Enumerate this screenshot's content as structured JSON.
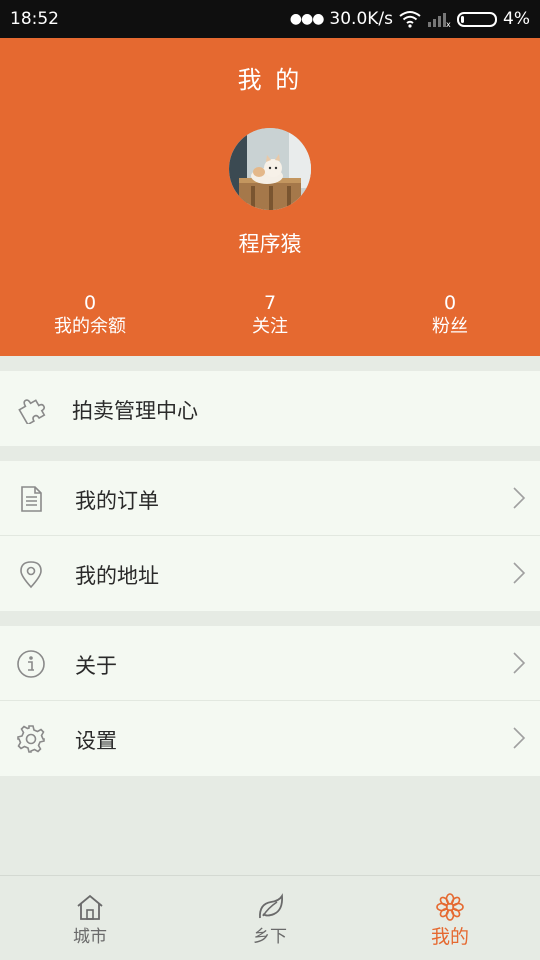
{
  "status_bar": {
    "time": "18:52",
    "speed": "30.0K/s",
    "battery": "4%"
  },
  "header": {
    "title": "我 的",
    "username": "程序猿",
    "stats": [
      {
        "value": "0",
        "label": "我的余额"
      },
      {
        "value": "7",
        "label": "关注"
      },
      {
        "value": "0",
        "label": "粉丝"
      }
    ]
  },
  "menu": {
    "auction": {
      "label": "拍卖管理中心",
      "icon": "puzzle-icon"
    },
    "orders": {
      "label": "我的订单",
      "icon": "document-icon"
    },
    "address": {
      "label": "我的地址",
      "icon": "location-pin-icon"
    },
    "about": {
      "label": "关于",
      "icon": "info-icon"
    },
    "settings": {
      "label": "设置",
      "icon": "gear-icon"
    }
  },
  "tabbar": {
    "items": [
      {
        "label": "城市",
        "icon": "home-icon"
      },
      {
        "label": "乡下",
        "icon": "leaf-icon"
      },
      {
        "label": "我的",
        "icon": "flower-icon"
      }
    ],
    "active_index": 2
  },
  "colors": {
    "accent": "#e56930",
    "background": "#e6ebe4",
    "card": "#f4f9f2"
  }
}
